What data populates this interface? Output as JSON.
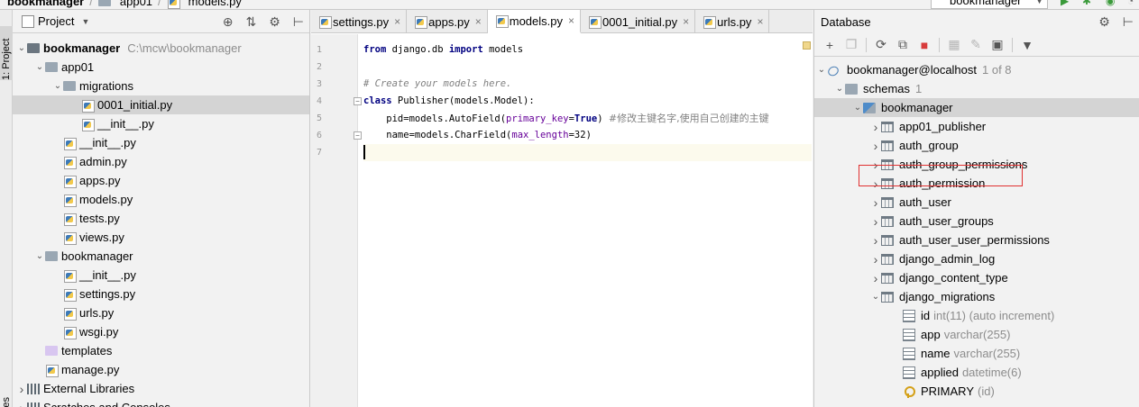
{
  "breadcrumb": [
    "bookmanager",
    "app01",
    "models.py"
  ],
  "run_config": "bookmanager",
  "strip": {
    "project_label": "1: Project",
    "bottom_label": "es"
  },
  "project": {
    "title": "Project",
    "tree": [
      {
        "label": "bookmanager",
        "path": "C:\\mcw\\bookmanager",
        "level": 0,
        "kind": "folder",
        "expanded": true,
        "bold": true
      },
      {
        "label": "app01",
        "level": 1,
        "kind": "folder",
        "expanded": true
      },
      {
        "label": "migrations",
        "level": 2,
        "kind": "folder",
        "expanded": true
      },
      {
        "label": "0001_initial.py",
        "level": 3,
        "kind": "py",
        "selected": true
      },
      {
        "label": "__init__.py",
        "level": 3,
        "kind": "py"
      },
      {
        "label": "__init__.py",
        "level": 2,
        "kind": "py"
      },
      {
        "label": "admin.py",
        "level": 2,
        "kind": "py"
      },
      {
        "label": "apps.py",
        "level": 2,
        "kind": "py"
      },
      {
        "label": "models.py",
        "level": 2,
        "kind": "py"
      },
      {
        "label": "tests.py",
        "level": 2,
        "kind": "py"
      },
      {
        "label": "views.py",
        "level": 2,
        "kind": "py"
      },
      {
        "label": "bookmanager",
        "level": 1,
        "kind": "folder",
        "expanded": true
      },
      {
        "label": "__init__.py",
        "level": 2,
        "kind": "py"
      },
      {
        "label": "settings.py",
        "level": 2,
        "kind": "py"
      },
      {
        "label": "urls.py",
        "level": 2,
        "kind": "py"
      },
      {
        "label": "wsgi.py",
        "level": 2,
        "kind": "py"
      },
      {
        "label": "templates",
        "level": 1,
        "kind": "template-folder"
      },
      {
        "label": "manage.py",
        "level": 1,
        "kind": "py"
      },
      {
        "label": "External Libraries",
        "level": 0,
        "kind": "lib",
        "expanded": false
      },
      {
        "label": "Scratches and Consoles",
        "level": 0,
        "kind": "lib",
        "expanded": false
      }
    ]
  },
  "editor": {
    "tabs": [
      {
        "label": "settings.py",
        "active": false
      },
      {
        "label": "apps.py",
        "active": false
      },
      {
        "label": "models.py",
        "active": true
      },
      {
        "label": "0001_initial.py",
        "active": false
      },
      {
        "label": "urls.py",
        "active": false
      }
    ],
    "line_numbers": [
      "1",
      "2",
      "3",
      "4",
      "5",
      "6",
      "7"
    ],
    "code": {
      "l1_kw1": "from",
      "l1_mod": " django.db ",
      "l1_kw2": "import",
      "l1_rest": " models",
      "l3": "# Create your models here.",
      "l4_kw": "class",
      "l4_rest": " Publisher(models.Model):",
      "l5_a": "    pid=models.AutoField(",
      "l5_par": "primary_key",
      "l5_eq": "=",
      "l5_true": "True",
      "l5_close": ") ",
      "l5_comment": "#修改主键名字,使用自己创建的主键",
      "l6_a": "    name=models.CharField(",
      "l6_par": "max_length",
      "l6_val": "=32",
      "l6_close": ")"
    }
  },
  "database": {
    "title": "Database",
    "connection": {
      "label": "bookmanager@localhost",
      "count": "1 of 8"
    },
    "schemas": {
      "label": "schemas",
      "count": "1"
    },
    "schema": "bookmanager",
    "tables": [
      "app01_publisher",
      "auth_group",
      "auth_group_permissions",
      "auth_permission",
      "auth_user",
      "auth_user_groups",
      "auth_user_user_permissions",
      "django_admin_log",
      "django_content_type",
      "django_migrations"
    ],
    "columns": [
      {
        "name": "id",
        "type": "int(11) (auto increment)",
        "kind": "pk"
      },
      {
        "name": "app",
        "type": "varchar(255)",
        "kind": "col"
      },
      {
        "name": "name",
        "type": "varchar(255)",
        "kind": "col"
      },
      {
        "name": "applied",
        "type": "datetime(6)",
        "kind": "col"
      },
      {
        "name": "PRIMARY",
        "type": "(id)",
        "kind": "key"
      }
    ]
  }
}
